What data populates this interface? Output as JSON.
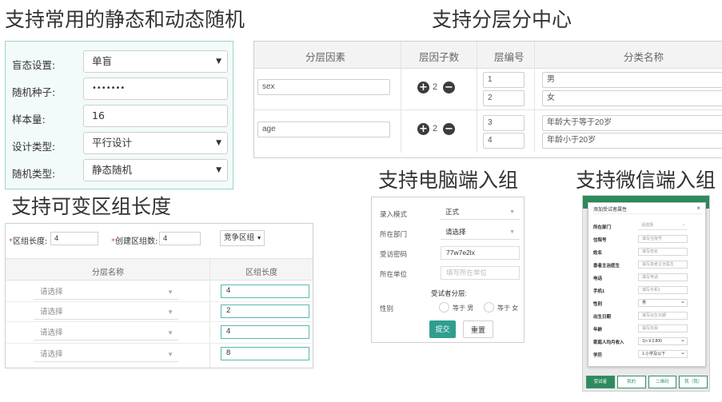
{
  "headings": {
    "random": "支持常用的静态和动态随机",
    "strata": "支持分层分中心",
    "block": "支持可变区组长度",
    "pc": "支持电脑端入组",
    "wechat": "支持微信端入组"
  },
  "random_settings": {
    "rows": [
      {
        "label": "盲态设置:",
        "value": "单盲",
        "dropdown": true
      },
      {
        "label": "随机种子:",
        "value": "•••••••",
        "dropdown": false
      },
      {
        "label": "样本量:",
        "value": "16",
        "dropdown": false
      },
      {
        "label": "设计类型:",
        "value": "平行设计",
        "dropdown": true
      },
      {
        "label": "随机类型:",
        "value": "静态随机",
        "dropdown": true
      }
    ]
  },
  "strata_table": {
    "headers": [
      "分层因素",
      "层因子数",
      "层编号",
      "分类名称"
    ],
    "factors": [
      {
        "name": "sex",
        "count": "2",
        "levels": [
          {
            "code": "1",
            "label": "男"
          },
          {
            "code": "2",
            "label": "女"
          }
        ]
      },
      {
        "name": "age",
        "count": "2",
        "levels": [
          {
            "code": "3",
            "label": "年龄大于等于20岁"
          },
          {
            "code": "4",
            "label": "年龄小于20岁"
          }
        ]
      }
    ],
    "plus_icon": "plus-circle-icon",
    "minus_icon": "minus-circle-icon"
  },
  "block_panel": {
    "block_length_label": "区组长度:",
    "block_length_value": "4",
    "block_count_label": "创建区组数:",
    "block_count_value": "4",
    "mode_value": "竞争区组",
    "required_mark": "*",
    "headers": [
      "分层名称",
      "区组长度"
    ],
    "rows": [
      {
        "strata": "请选择",
        "length": "4"
      },
      {
        "strata": "请选择",
        "length": "2"
      },
      {
        "strata": "请选择",
        "length": "4"
      },
      {
        "strata": "请选择",
        "length": "8"
      }
    ]
  },
  "pc_form": {
    "mode_label": "录入模式",
    "mode_value": "正式",
    "dept_label": "所在部门",
    "dept_value": "请选择",
    "code_label": "受访密码",
    "code_value": "77w7e2lx",
    "unit_label": "所在单位",
    "unit_placeholder": "填写所在单位",
    "section_title": "受试者分层:",
    "gender_label": "性别",
    "opt_male": "等于 男",
    "opt_female": "等于 女",
    "submit": "提交",
    "reset": "重置"
  },
  "wechat": {
    "modal_title": "添加受试者属性",
    "close": "×",
    "fields": [
      {
        "label": "所在部门",
        "value": "请选择",
        "type": "select-light"
      },
      {
        "label": "住院号",
        "value": "填写住院号",
        "type": "text"
      },
      {
        "label": "姓名",
        "value": "填写姓名",
        "type": "text"
      },
      {
        "label": "患者主治医生",
        "value": "填写患者主治医生",
        "type": "text"
      },
      {
        "label": "电话",
        "value": "填写电话",
        "type": "text"
      },
      {
        "label": "手机1",
        "value": "填写手机1",
        "type": "text"
      },
      {
        "label": "性别",
        "value": "男",
        "type": "select"
      },
      {
        "label": "出生日期",
        "value": "填写出生日期",
        "type": "text"
      },
      {
        "label": "年龄",
        "value": "填写年龄",
        "type": "text"
      },
      {
        "label": "家庭人均月收入",
        "value": "1)<￥2,800",
        "type": "select"
      },
      {
        "label": "学历",
        "value": "1.小学及以下",
        "type": "select"
      }
    ],
    "tabs": [
      "受试者",
      "我的",
      "二维码",
      "我（我）"
    ]
  },
  "colors": {
    "teal": "#2f9e8f",
    "teal_border": "#5ab8b0",
    "wechat_green": "#2f8a60",
    "required": "#d9534f"
  }
}
